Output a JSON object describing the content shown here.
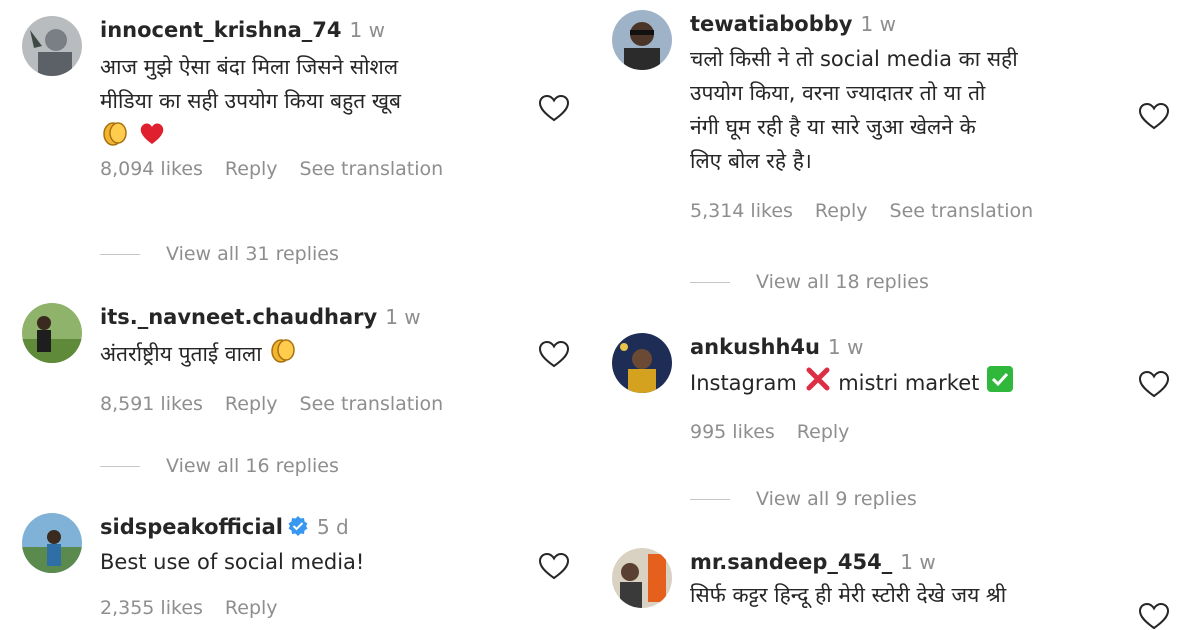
{
  "comments": [
    {
      "username": "innocent_krishna_74",
      "time": "1 w",
      "lines": [
        "आज मुझे ऐसा बंदा मिला जिसने सोशल",
        "मीडिया का सही उपयोग किया बहुत खूब"
      ],
      "emojis": [
        "clapping-hands-emoji",
        "red-heart-emoji"
      ],
      "likes": "8,094 likes",
      "reply": "Reply",
      "translate": "See translation",
      "view_replies": "View all 31 replies"
    },
    {
      "username": "its._navneet.chaudhary",
      "time": "1 w",
      "lines": [
        "अंतर्राष्ट्रीय पुताई वाला"
      ],
      "emojis": [
        "clapping-hands-emoji"
      ],
      "likes": "8,591 likes",
      "reply": "Reply",
      "translate": "See translation",
      "view_replies": "View all 16 replies"
    },
    {
      "username": "sidspeakofficial",
      "verified": true,
      "time": "5 d",
      "lines": [
        "Best use of social media!"
      ],
      "likes": "2,355 likes",
      "reply": "Reply"
    },
    {
      "username": "tewatiabobby",
      "time": "1 w",
      "lines": [
        "चलो किसी ने तो social media का सही",
        "उपयोग किया, वरना ज्यादातर तो या तो",
        "नंगी घूम रही है या सारे जुआ खेलने के",
        "लिए बोल रहे है।"
      ],
      "likes": "5,314 likes",
      "reply": "Reply",
      "translate": "See translation",
      "view_replies": "View all 18 replies"
    },
    {
      "username": "ankushh4u",
      "time": "1 w",
      "text_a": "Instagram",
      "text_b": "mistri market",
      "emojis": [
        "cross-mark-emoji",
        "check-mark-button-emoji"
      ],
      "likes": "995 likes",
      "reply": "Reply",
      "view_replies": "View all 9 replies"
    },
    {
      "username": "mr.sandeep_454_",
      "time": "1 w",
      "lines": [
        "सिर्फ कट्टर हिन्दू ही मेरी स्टोरी देखे जय श्री"
      ]
    }
  ],
  "icons": {
    "like": "heart-outline-icon",
    "verified": "verified-badge-icon"
  },
  "colors": {
    "text": "#262626",
    "secondary": "#8e8e8e",
    "verified": "#3897f0",
    "heart": "#ed4956"
  }
}
